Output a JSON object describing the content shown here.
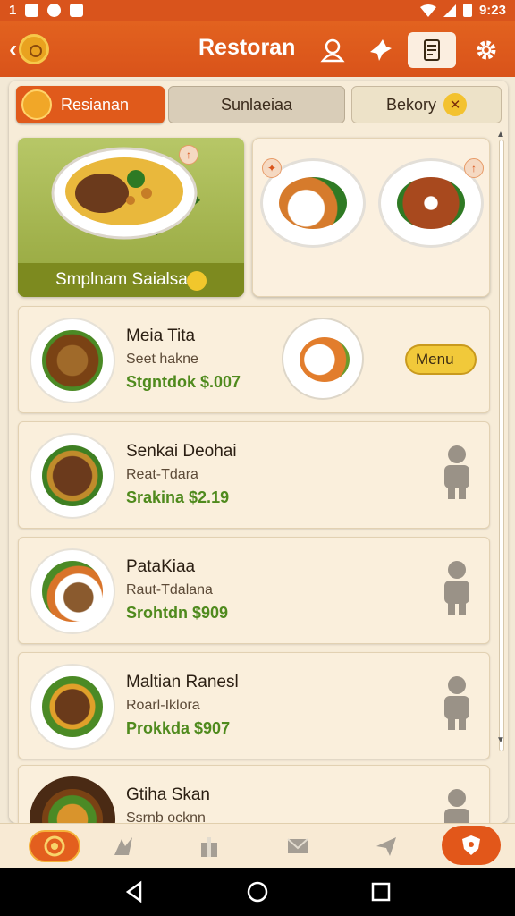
{
  "status_bar": {
    "left_text": "1",
    "time": "9:23"
  },
  "app_bar": {
    "title": "Restoran"
  },
  "tabs": [
    {
      "label": "Resianan"
    },
    {
      "label": "Sunlaeiaa"
    },
    {
      "label": "Bekory"
    }
  ],
  "featured": {
    "caption": "Smplnam Saialsa"
  },
  "items": [
    {
      "name": "Meia Tita",
      "desc": "Seet hakne",
      "price": "Stgntdok $.007",
      "button_label": "Menu"
    },
    {
      "name": "Senkai Deohai",
      "desc": "Reat-Tdara",
      "price": "Srakina $2.19"
    },
    {
      "name": "PataKiaa",
      "desc": "Raut-Tdalana",
      "price": "Srohtdn $909"
    },
    {
      "name": "Maltian Ranesl",
      "desc": "Roarl-Iklora",
      "price": "Prokkda $907"
    },
    {
      "name": "Gtiha Skan",
      "desc": "Ssrnb ocknn",
      "price": ""
    }
  ],
  "colors": {
    "primary": "#d9541c",
    "accent": "#f1c93a",
    "price": "#4f8a1d",
    "background": "#f3e9d6"
  }
}
